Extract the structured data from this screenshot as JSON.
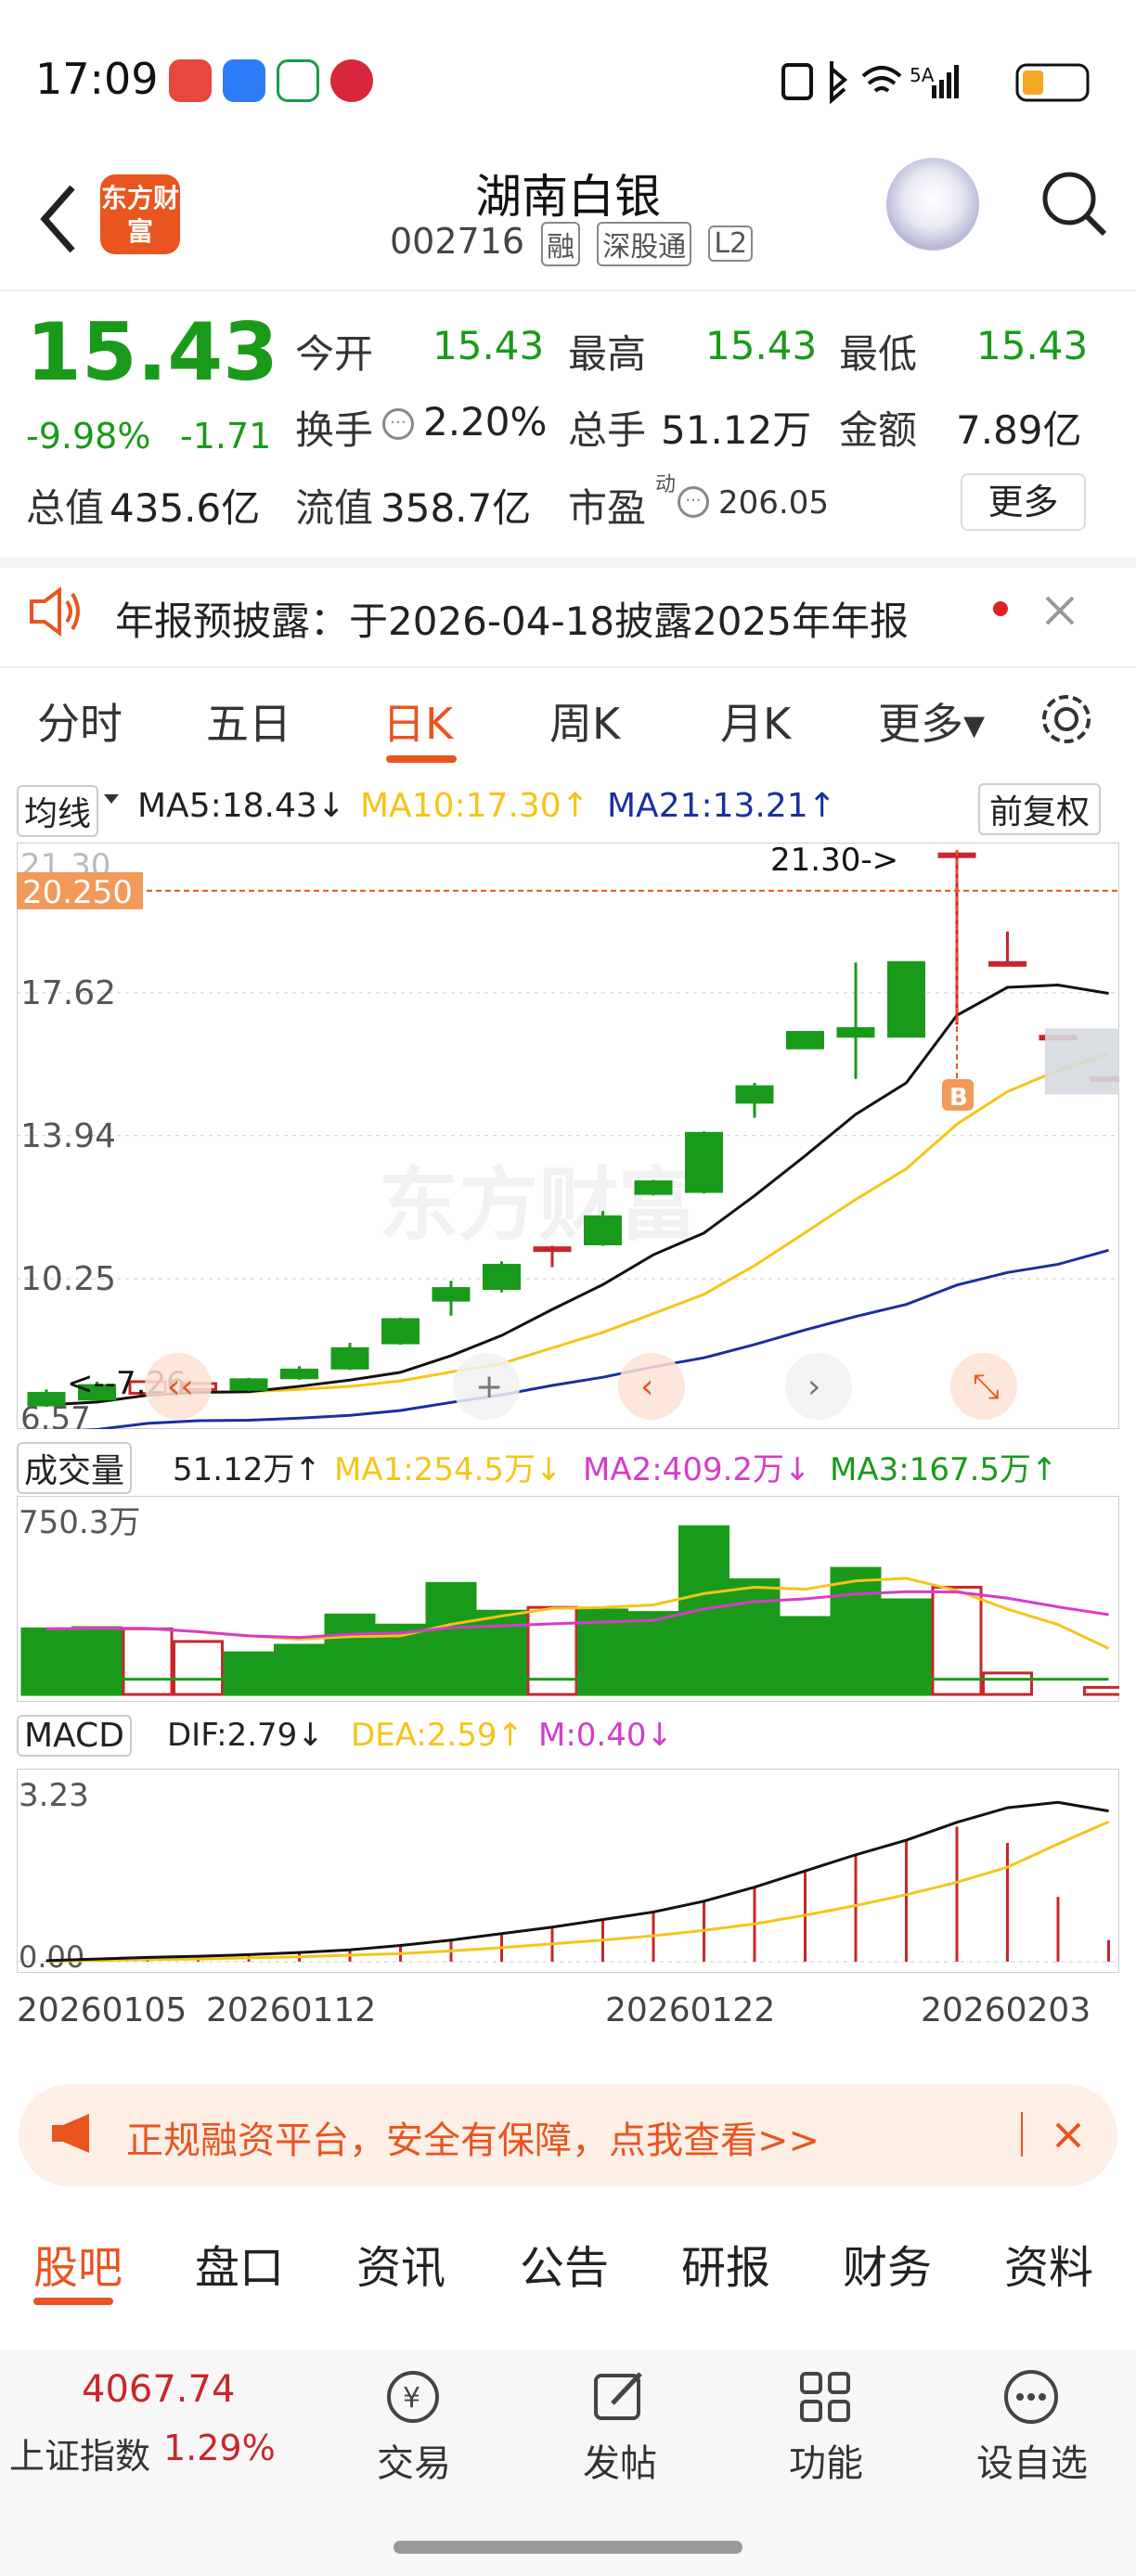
{
  "status_bar": {
    "time": "17:09",
    "network": "5A",
    "icons": [
      "nfc-icon",
      "bluetooth-icon",
      "wifi-icon",
      "signal-icon",
      "battery-icon"
    ]
  },
  "header": {
    "title": "湖南白银",
    "code": "002716",
    "tags": [
      "融",
      "深股通",
      "L2"
    ],
    "logo_text": "东方财富"
  },
  "quote": {
    "price": "15.43",
    "change_pct": "-9.98%",
    "change": "-1.71",
    "open_label": "今开",
    "open": "15.43",
    "high_label": "最高",
    "high": "15.43",
    "low_label": "最低",
    "low": "15.43",
    "turnover_label": "换手",
    "turnover": "2.20%",
    "volume_label": "总手",
    "volume": "51.12万",
    "amount_label": "金额",
    "amount": "7.89亿",
    "mcap_label": "总值",
    "mcap": "435.6亿",
    "float_label": "流值",
    "float": "358.7亿",
    "pe_label": "市盈",
    "pe_sup": "动",
    "pe": "206.05",
    "more": "更多"
  },
  "notice": {
    "text": "年报预披露：于2026-04-18披露2025年年报"
  },
  "chart_tabs": [
    "分时",
    "五日",
    "日K",
    "周K",
    "月K",
    "更多▾"
  ],
  "active_tab": "日K",
  "ma_legend": {
    "selector": "均线",
    "ma5": "MA5:18.43↓",
    "ma10": "MA10:17.30↑",
    "ma21": "MA21:13.21↑",
    "adjust": "前复权"
  },
  "vol_legend": {
    "selector": "成交量",
    "v": "51.12万↑",
    "ma1": "MA1:254.5万↓",
    "ma2": "MA2:409.2万↓",
    "ma3": "MA3:167.5万↑"
  },
  "macd_legend": {
    "selector": "MACD",
    "dif": "DIF:2.79↓",
    "dea": "DEA:2.59↑",
    "m": "M:0.40↓"
  },
  "axis": {
    "p_top": "21.30",
    "p_cross": "20.250",
    "p1": "17.62",
    "p2": "13.94",
    "p3": "10.25",
    "p_bot": "6.57",
    "max_label": "21.30->",
    "min_label": "<--7.26",
    "vol_max": "750.3万",
    "macd_max": "3.23",
    "macd_zero": "0.00",
    "b_mark": "B",
    "watermark": "东方财富"
  },
  "dates": [
    "20260105",
    "20260112",
    "20260122",
    "20260203"
  ],
  "chart_data": {
    "type": "candlestick",
    "candles": [
      {
        "o": 7.3,
        "c": 7.0,
        "h": 7.4,
        "l": 6.95
      },
      {
        "o": 7.5,
        "c": 7.15,
        "h": 7.6,
        "l": 7.1
      },
      {
        "o": 7.3,
        "c": 7.6,
        "h": 7.65,
        "l": 7.26
      },
      {
        "o": 7.4,
        "c": 7.55,
        "h": 7.6,
        "l": 7.35
      },
      {
        "o": 7.65,
        "c": 7.4,
        "h": 7.7,
        "l": 7.35
      },
      {
        "o": 7.9,
        "c": 7.7,
        "h": 8.0,
        "l": 7.65
      },
      {
        "o": 8.45,
        "c": 7.95,
        "h": 8.6,
        "l": 7.9
      },
      {
        "o": 9.2,
        "c": 8.6,
        "h": 9.25,
        "l": 8.55
      },
      {
        "o": 10.0,
        "c": 9.7,
        "h": 10.2,
        "l": 9.3
      },
      {
        "o": 10.6,
        "c": 10.0,
        "h": 10.7,
        "l": 9.9
      },
      {
        "o": 11.05,
        "c": 11.05,
        "h": 11.1,
        "l": 10.55
      },
      {
        "o": 11.85,
        "c": 11.15,
        "h": 12.0,
        "l": 11.1
      },
      {
        "o": 12.75,
        "c": 12.45,
        "h": 12.8,
        "l": 12.4
      },
      {
        "o": 14.0,
        "c": 12.5,
        "h": 14.05,
        "l": 12.45
      },
      {
        "o": 15.2,
        "c": 14.8,
        "h": 15.3,
        "l": 14.4
      },
      {
        "o": 16.6,
        "c": 16.2,
        "h": 16.6,
        "l": 16.2
      },
      {
        "o": 16.7,
        "c": 16.5,
        "h": 18.4,
        "l": 15.4
      },
      {
        "o": 18.4,
        "c": 16.5,
        "h": 18.4,
        "l": 16.5
      },
      {
        "o": 21.2,
        "c": 21.2,
        "h": 21.3,
        "l": 16.8
      },
      {
        "o": 18.4,
        "c": 18.4,
        "h": 19.2,
        "l": 18.3
      },
      {
        "o": 16.5,
        "c": 16.5,
        "h": 16.5,
        "l": 16.4
      },
      {
        "o": 15.43,
        "c": 15.43,
        "h": 15.43,
        "l": 15.43
      }
    ],
    "ylim": [
      6.57,
      21.3
    ],
    "volume": [
      260,
      265,
      260,
      210,
      165,
      195,
      315,
      275,
      440,
      330,
      345,
      335,
      325,
      665,
      455,
      305,
      500,
      375,
      425,
      85,
      0,
      28
    ],
    "vol_max": 750.3,
    "macd_dif": [
      0.02,
      0.05,
      0.08,
      0.1,
      0.13,
      0.17,
      0.22,
      0.3,
      0.4,
      0.52,
      0.64,
      0.78,
      0.92,
      1.12,
      1.38,
      1.68,
      1.98,
      2.25,
      2.58,
      2.85,
      2.95,
      2.79
    ],
    "macd_dea": [
      0.01,
      0.02,
      0.04,
      0.05,
      0.07,
      0.09,
      0.12,
      0.15,
      0.2,
      0.26,
      0.33,
      0.4,
      0.48,
      0.58,
      0.7,
      0.86,
      1.04,
      1.24,
      1.47,
      1.75,
      2.18,
      2.59
    ],
    "macd_m": [
      0.02,
      0.05,
      0.08,
      0.1,
      0.13,
      0.17,
      0.22,
      0.3,
      0.4,
      0.52,
      0.64,
      0.78,
      0.92,
      1.12,
      1.38,
      1.68,
      1.98,
      2.25,
      2.5,
      2.2,
      1.2,
      0.4
    ],
    "macd_max": 3.23
  },
  "banner": {
    "text": "正规融资平台，安全有保障，点我查看>>"
  },
  "bottom_tabs": [
    "股吧",
    "盘口",
    "资讯",
    "公告",
    "研报",
    "财务",
    "资料"
  ],
  "index": {
    "value": "4067.74",
    "name": "上证指数",
    "pct": "1.29%"
  },
  "nav": [
    "交易",
    "发帖",
    "功能",
    "设自选"
  ],
  "colors": {
    "up": "#c8262c",
    "down": "#1a9a1a",
    "accent": "#e8551f",
    "ma10": "#f5c518",
    "ma21": "#1a2fa0",
    "vol_ma2": "#d63cc8"
  }
}
